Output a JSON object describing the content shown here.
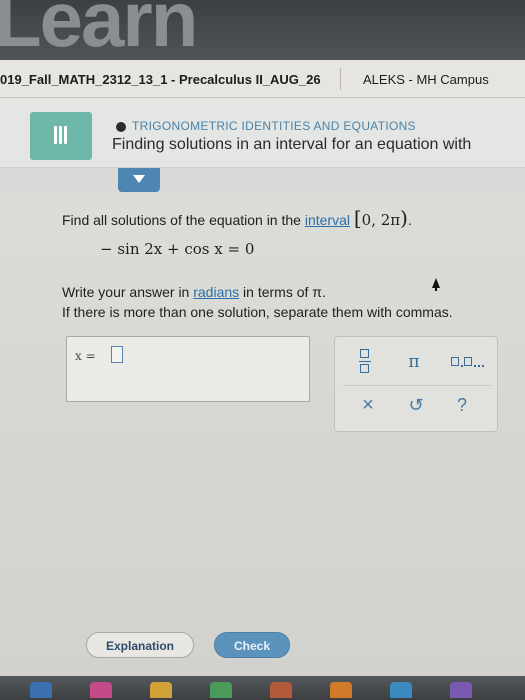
{
  "banner": {
    "text": "Learn"
  },
  "browser": {
    "course_tab": "019_Fall_MATH_2312_13_1 - Precalculus II_AUG_26",
    "campus_tab": "ALEKS - MH Campus"
  },
  "topic": {
    "kicker": "TRIGONOMETRIC IDENTITIES AND EQUATIONS",
    "title": "Finding solutions in an interval for an equation with"
  },
  "question": {
    "prompt_prefix": "Find all solutions of the equation in the ",
    "prompt_link": "interval",
    "interval_open": "[",
    "interval_body": "0, 2π",
    "interval_close": ")",
    "prompt_suffix": ".",
    "equation": "− sin 2x + cos x = 0",
    "instruction_prefix": "Write your answer in ",
    "instruction_link": "radians",
    "instruction_suffix": " in terms of π.",
    "instruction_line2": "If there is more than one solution, separate them with commas."
  },
  "answer": {
    "label": "x =",
    "value": ""
  },
  "palette": {
    "pi_symbol": "π",
    "clear_symbol": "×",
    "undo_symbol": "↺",
    "help_symbol": "?"
  },
  "buttons": {
    "explanation": "Explanation",
    "check": "Check"
  },
  "colors": {
    "accent_teal": "#6fb7a8",
    "accent_blue": "#4d86b0",
    "link_blue": "#2d6fa8",
    "check_button": "#5b93bd"
  },
  "icons": [
    "hamburger-icon",
    "chevron-down-icon",
    "fraction-icon",
    "list-icon",
    "close-icon",
    "undo-icon",
    "help-icon"
  ]
}
